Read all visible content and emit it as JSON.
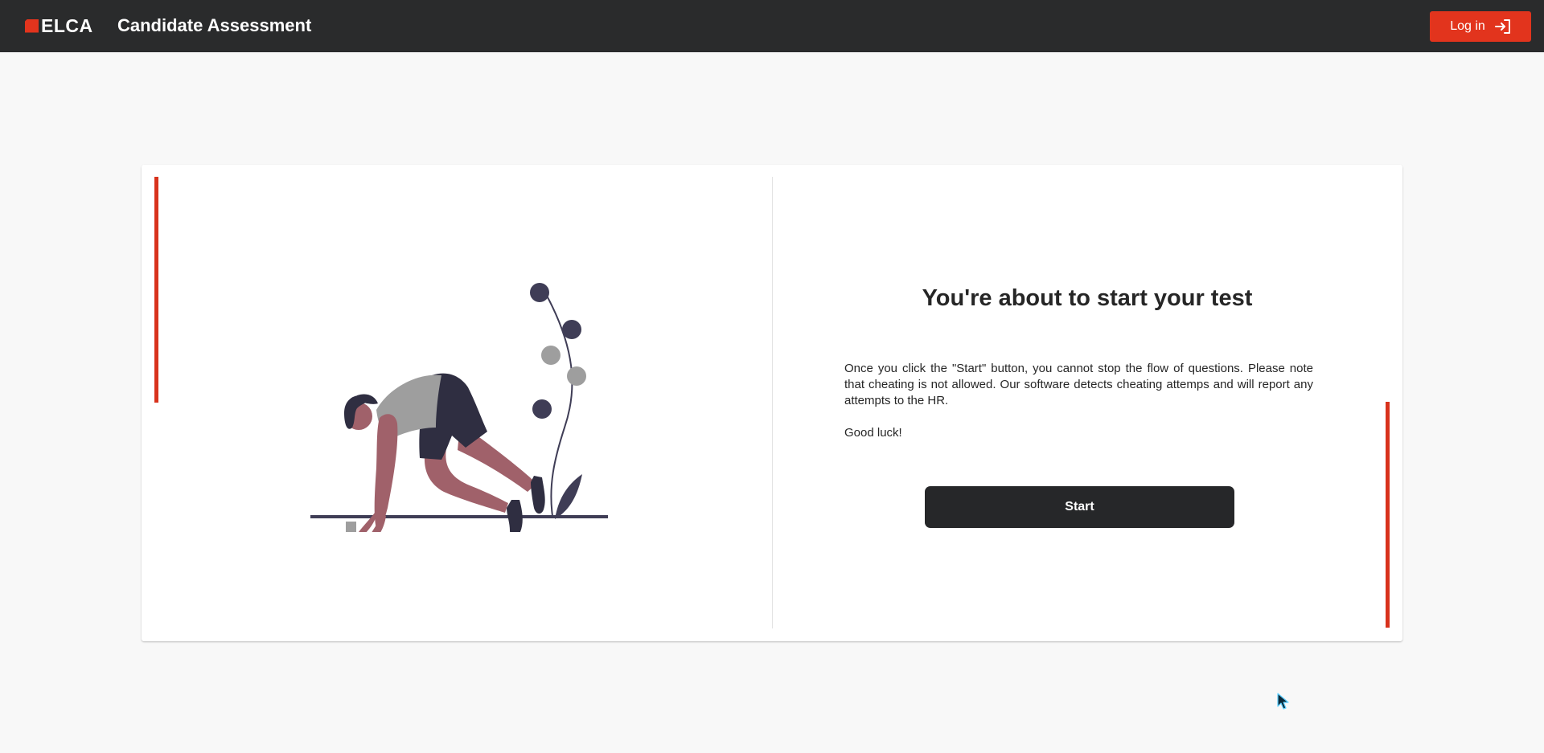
{
  "header": {
    "logo_text": "ELCA",
    "title": "Candidate Assessment",
    "login_label": "Log in",
    "login_icon": "sign-in-icon"
  },
  "colors": {
    "brand_red": "#e2341d",
    "header_bg": "#2a2b2c",
    "start_button_bg": "#262729",
    "page_bg": "#f8f8f8"
  },
  "main": {
    "heading": "You're about to start your test",
    "description": "Once you click the \"Start\" button, you cannot stop the flow of questions. Please note that cheating is not allowed. Our software detects cheating attemps and will report any attempts to the HR.",
    "closing": "Good luck!",
    "start_label": "Start"
  }
}
